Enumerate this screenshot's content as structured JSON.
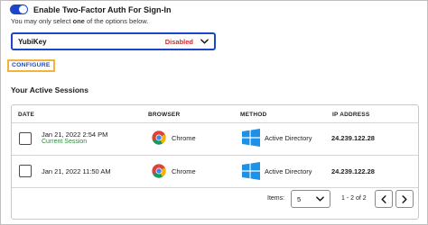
{
  "two_factor": {
    "toggle_label": "Enable Two-Factor Auth For Sign-In",
    "hint_pre": "You may only select ",
    "hint_bold": "one",
    "hint_post": " of the options below.",
    "enabled": true
  },
  "method_select": {
    "value": "YubiKey",
    "status": "Disabled"
  },
  "configure_label": "CONFIGURE",
  "sessions": {
    "title": "Your Active Sessions",
    "columns": [
      "DATE",
      "BROWSER",
      "METHOD",
      "IP ADDRESS"
    ],
    "rows": [
      {
        "date": "Jan 21, 2022 2:54 PM",
        "note": "Current Session",
        "browser": "Chrome",
        "method": "Active Directory",
        "ip": "24.239.122.28"
      },
      {
        "date": "Jan 21, 2022 11:50 AM",
        "note": "",
        "browser": "Chrome",
        "method": "Active Directory",
        "ip": "24.239.122.28"
      }
    ],
    "pagination": {
      "items_label": "Items:",
      "items_value": "5",
      "range": "1 - 2 of 2"
    }
  },
  "colors": {
    "accent": "#1a47c9",
    "danger": "#d0272d",
    "success": "#2e8b3e",
    "highlight": "#f2b33c"
  },
  "icons": {
    "browser": "chrome-icon",
    "method": "windows-icon"
  }
}
